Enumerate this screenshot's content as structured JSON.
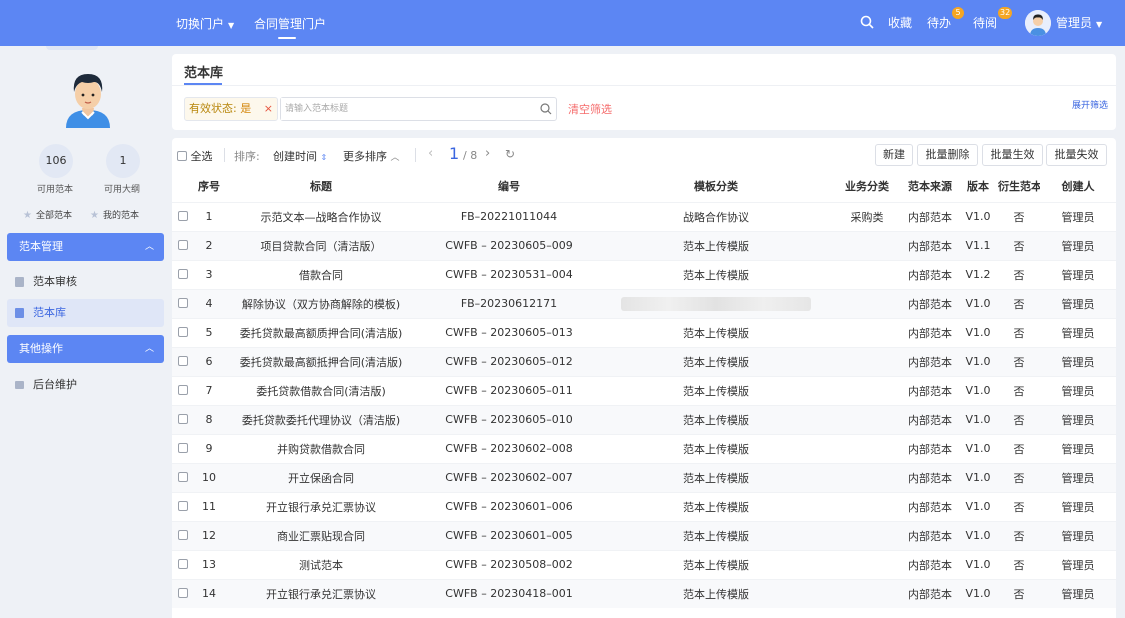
{
  "topbar": {
    "switch_portal": "切换门户",
    "contract_portal": "合同管理门户",
    "favorites": "收藏",
    "todo": "待办",
    "todo_count": "5",
    "to_read": "待阅",
    "to_read_count": "32",
    "user": "管理员"
  },
  "sidebar": {
    "stats": [
      {
        "value": "106",
        "label": "可用范本"
      },
      {
        "value": "1",
        "label": "可用大纲"
      }
    ],
    "all_templates": "全部范本",
    "my_templates": "我的范本",
    "group_template_mgmt": "范本管理",
    "item_review": "范本审核",
    "item_library": "范本库",
    "group_other": "其他操作",
    "item_backend": "后台维护"
  },
  "main": {
    "title": "范本库",
    "filter_key": "有效状态:",
    "filter_value": "是",
    "filter_remove": "×",
    "search_placeholder": "请输入范本标题",
    "clear_filter": "清空筛选",
    "expand_filter": "展开筛选"
  },
  "toolbar": {
    "select_all": "全选",
    "sort_label": "排序:",
    "sort_field": "创建时间",
    "more_sort": "更多排序",
    "page_current": "1",
    "page_total": "/ 8",
    "new": "新建",
    "batch_delete": "批量删除",
    "batch_enable": "批量生效",
    "batch_disable": "批量失效"
  },
  "table": {
    "columns": [
      "序号",
      "标题",
      "编号",
      "模板分类",
      "业务分类",
      "范本来源",
      "版本",
      "衍生范本",
      "创建人"
    ],
    "rows": [
      {
        "no": "1",
        "title": "示范文本—战略合作协议",
        "code": "FB–20221011044",
        "category": "战略合作协议",
        "business": "采购类",
        "source": "内部范本",
        "version": "V1.0",
        "derived": "否",
        "creator": "管理员"
      },
      {
        "no": "2",
        "title": "项目贷款合同（清洁版）",
        "code": "CWFB – 20230605–009",
        "category": "范本上传模版",
        "business": "",
        "source": "内部范本",
        "version": "V1.1",
        "derived": "否",
        "creator": "管理员"
      },
      {
        "no": "3",
        "title": "借款合同",
        "code": "CWFB – 20230531–004",
        "category": "范本上传模版",
        "business": "",
        "source": "内部范本",
        "version": "V1.2",
        "derived": "否",
        "creator": "管理员"
      },
      {
        "no": "4",
        "title": "解除协议（双方协商解除的模板)",
        "code": "FB–20230612171",
        "category": "",
        "business": "",
        "source": "内部范本",
        "version": "V1.0",
        "derived": "否",
        "creator": "管理员"
      },
      {
        "no": "5",
        "title": "委托贷款最高额质押合同(清洁版)",
        "code": "CWFB – 20230605–013",
        "category": "范本上传模版",
        "business": "",
        "source": "内部范本",
        "version": "V1.0",
        "derived": "否",
        "creator": "管理员"
      },
      {
        "no": "6",
        "title": "委托贷款最高额抵押合同(清洁版)",
        "code": "CWFB – 20230605–012",
        "category": "范本上传模版",
        "business": "",
        "source": "内部范本",
        "version": "V1.0",
        "derived": "否",
        "creator": "管理员"
      },
      {
        "no": "7",
        "title": "委托贷款借款合同(清洁版)",
        "code": "CWFB – 20230605–011",
        "category": "范本上传模版",
        "business": "",
        "source": "内部范本",
        "version": "V1.0",
        "derived": "否",
        "creator": "管理员"
      },
      {
        "no": "8",
        "title": "委托贷款委托代理协议（清洁版)",
        "code": "CWFB – 20230605–010",
        "category": "范本上传模版",
        "business": "",
        "source": "内部范本",
        "version": "V1.0",
        "derived": "否",
        "creator": "管理员"
      },
      {
        "no": "9",
        "title": "并购贷款借款合同",
        "code": "CWFB – 20230602–008",
        "category": "范本上传模版",
        "business": "",
        "source": "内部范本",
        "version": "V1.0",
        "derived": "否",
        "creator": "管理员"
      },
      {
        "no": "10",
        "title": "开立保函合同",
        "code": "CWFB – 20230602–007",
        "category": "范本上传模版",
        "business": "",
        "source": "内部范本",
        "version": "V1.0",
        "derived": "否",
        "creator": "管理员"
      },
      {
        "no": "11",
        "title": "开立银行承兑汇票协议",
        "code": "CWFB – 20230601–006",
        "category": "范本上传模版",
        "business": "",
        "source": "内部范本",
        "version": "V1.0",
        "derived": "否",
        "creator": "管理员"
      },
      {
        "no": "12",
        "title": "商业汇票贴现合同",
        "code": "CWFB – 20230601–005",
        "category": "范本上传模版",
        "business": "",
        "source": "内部范本",
        "version": "V1.0",
        "derived": "否",
        "creator": "管理员"
      },
      {
        "no": "13",
        "title": "测试范本",
        "code": "CWFB – 20230508–002",
        "category": "范本上传模版",
        "business": "",
        "source": "内部范本",
        "version": "V1.0",
        "derived": "否",
        "creator": "管理员"
      },
      {
        "no": "14",
        "title": "开立银行承兑汇票协议",
        "code": "CWFB – 20230418–001",
        "category": "范本上传模版",
        "business": "",
        "source": "内部范本",
        "version": "V1.0",
        "derived": "否",
        "creator": "管理员"
      }
    ]
  }
}
